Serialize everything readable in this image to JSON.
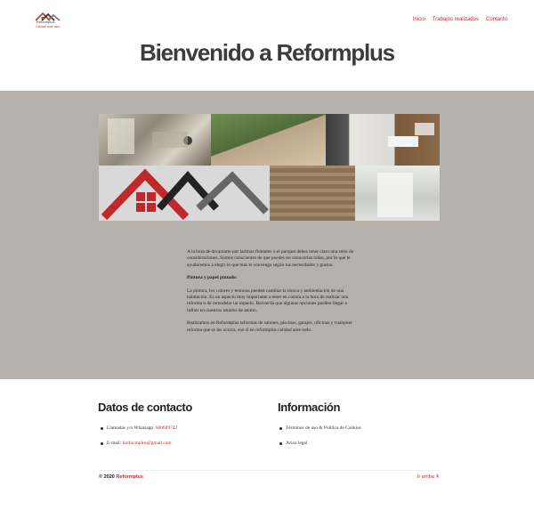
{
  "header": {
    "logo_name": "Reformplus",
    "logo_tagline": "Calidad ante todo",
    "nav": [
      "Inicio",
      "Trabajos realizados",
      "Contacto"
    ]
  },
  "hero": {
    "title": "Bienvenido a Reformplus"
  },
  "content": {
    "p1": "A la hora de decantarte por tarimas flotantes o el parquet debes tener claro una serie de consideraciones. Somos conscientes de que puedes no conocerlas todas, por lo que  te ayudaremos a elegir lo que más te convenga según tus necesidades y gustos.",
    "heading": "Pintura y papel pintado:",
    "p2": "La pintura, los colores y texturas pueden cambiar la tónica y ambientación de una habitación. Es un aspecto muy importante a tener en cuenta a la hora de realizar una reforma o de remodelar un espacio. Recuerda que algunas opciones pueden llegar a influir en nuestros estados de ánimo.",
    "p3": "Realizamos en Reformplus reformas de salones, piscinas, garajes, oficinas y cualquier reforma que se les ocurra, eso sí en reformplus calidad ante todo."
  },
  "footer": {
    "contact_title": "Datos de contacto",
    "phone_label": "Llamadas y/o Whatsapp: ",
    "phone": "600609742",
    "email_label": "E-mail: ",
    "email": "iirefocmplus@gmail.com",
    "info_title": "Información",
    "info_items": [
      "Términos de uso & Política de Cookies",
      "Aviso legal"
    ],
    "copyright_prefix": "© 2020 ",
    "copyright_brand": "Reformplus",
    "back_to_top": "Ir arriba ⇞"
  },
  "colors": {
    "accent": "#c62828",
    "band": "#b6b0ab",
    "title": "#3c3c3c"
  }
}
